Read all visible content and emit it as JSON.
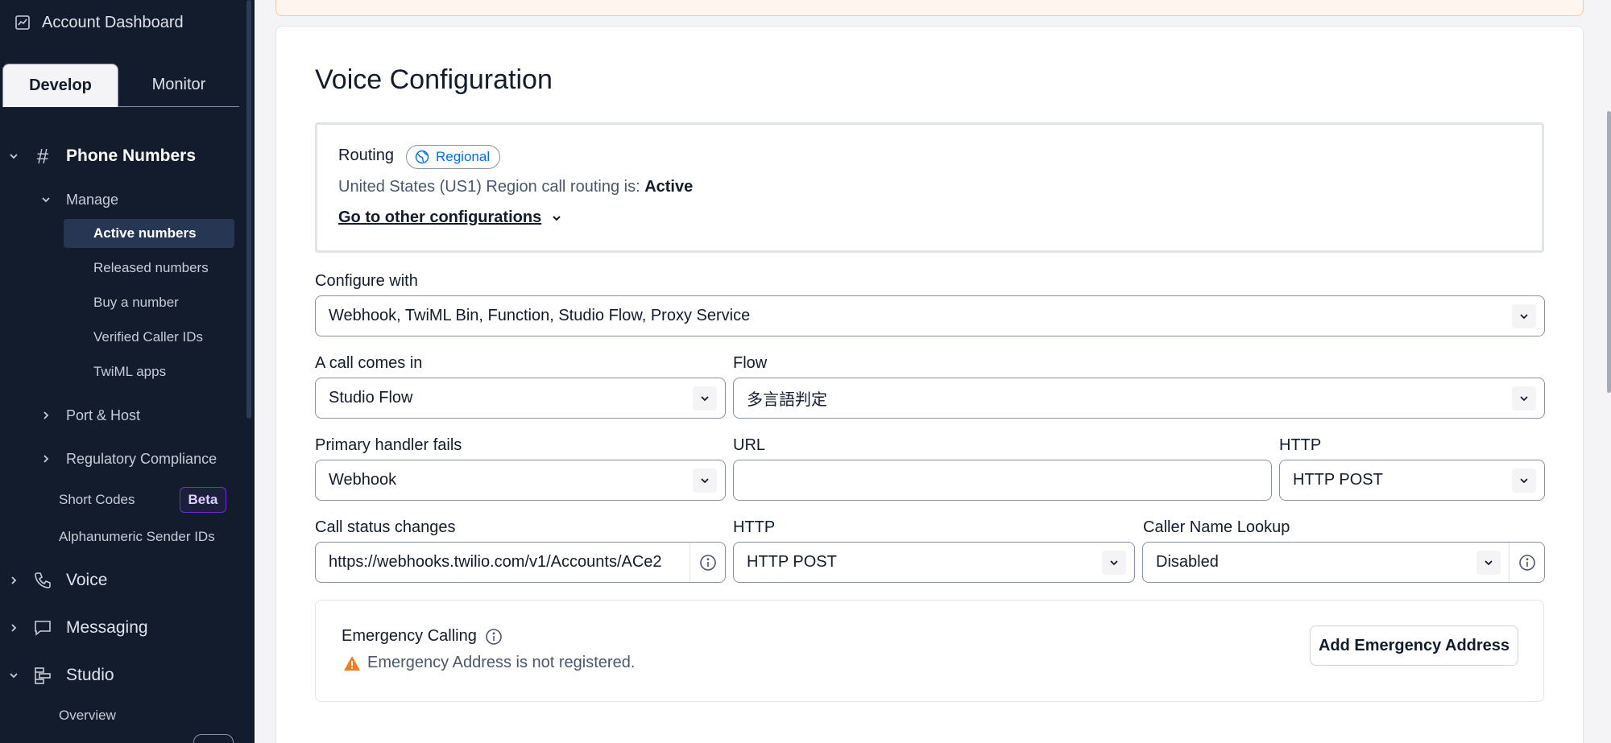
{
  "sidebar": {
    "account_dashboard": "Account Dashboard",
    "tabs": {
      "develop": "Develop",
      "monitor": "Monitor"
    },
    "phone_numbers": "Phone Numbers",
    "manage": "Manage",
    "manage_items": [
      "Active numbers",
      "Released numbers",
      "Buy a number",
      "Verified Caller IDs",
      "TwiML apps"
    ],
    "port_host": "Port & Host",
    "regulatory_compliance": "Regulatory Compliance",
    "short_codes": "Short Codes",
    "beta_badge": "Beta",
    "alphanumeric": "Alphanumeric Sender IDs",
    "voice": "Voice",
    "messaging": "Messaging",
    "studio": "Studio",
    "overview": "Overview"
  },
  "main": {
    "title": "Voice Configuration",
    "routing": {
      "label": "Routing",
      "badge": "Regional",
      "status_prefix": "United States (US1) Region call routing is: ",
      "status_value": "Active",
      "goto_link": "Go to other configurations"
    },
    "configure_with": {
      "label": "Configure with",
      "value": "Webhook, TwiML Bin, Function, Studio Flow, Proxy Service"
    },
    "call_comes_in": {
      "label": "A call comes in",
      "value": "Studio Flow"
    },
    "flow": {
      "label": "Flow",
      "value": "多言語判定"
    },
    "primary_handler": {
      "label": "Primary handler fails",
      "value": "Webhook"
    },
    "url": {
      "label": "URL",
      "value": ""
    },
    "http_primary": {
      "label": "HTTP",
      "value": "HTTP POST"
    },
    "call_status": {
      "label": "Call status changes",
      "value": "https://webhooks.twilio.com/v1/Accounts/ACe2"
    },
    "http_status": {
      "label": "HTTP",
      "value": "HTTP POST"
    },
    "caller_name": {
      "label": "Caller Name Lookup",
      "value": "Disabled"
    },
    "emergency": {
      "title": "Emergency Calling",
      "warning": "Emergency Address is not registered.",
      "button": "Add Emergency Address"
    }
  },
  "colors": {
    "sidebar_bg": "#121c2d",
    "active_item_bg": "#263653",
    "link_blue": "#006dfa",
    "beta_purple": "#6d2ed1",
    "warning_orange": "#f47c22"
  }
}
